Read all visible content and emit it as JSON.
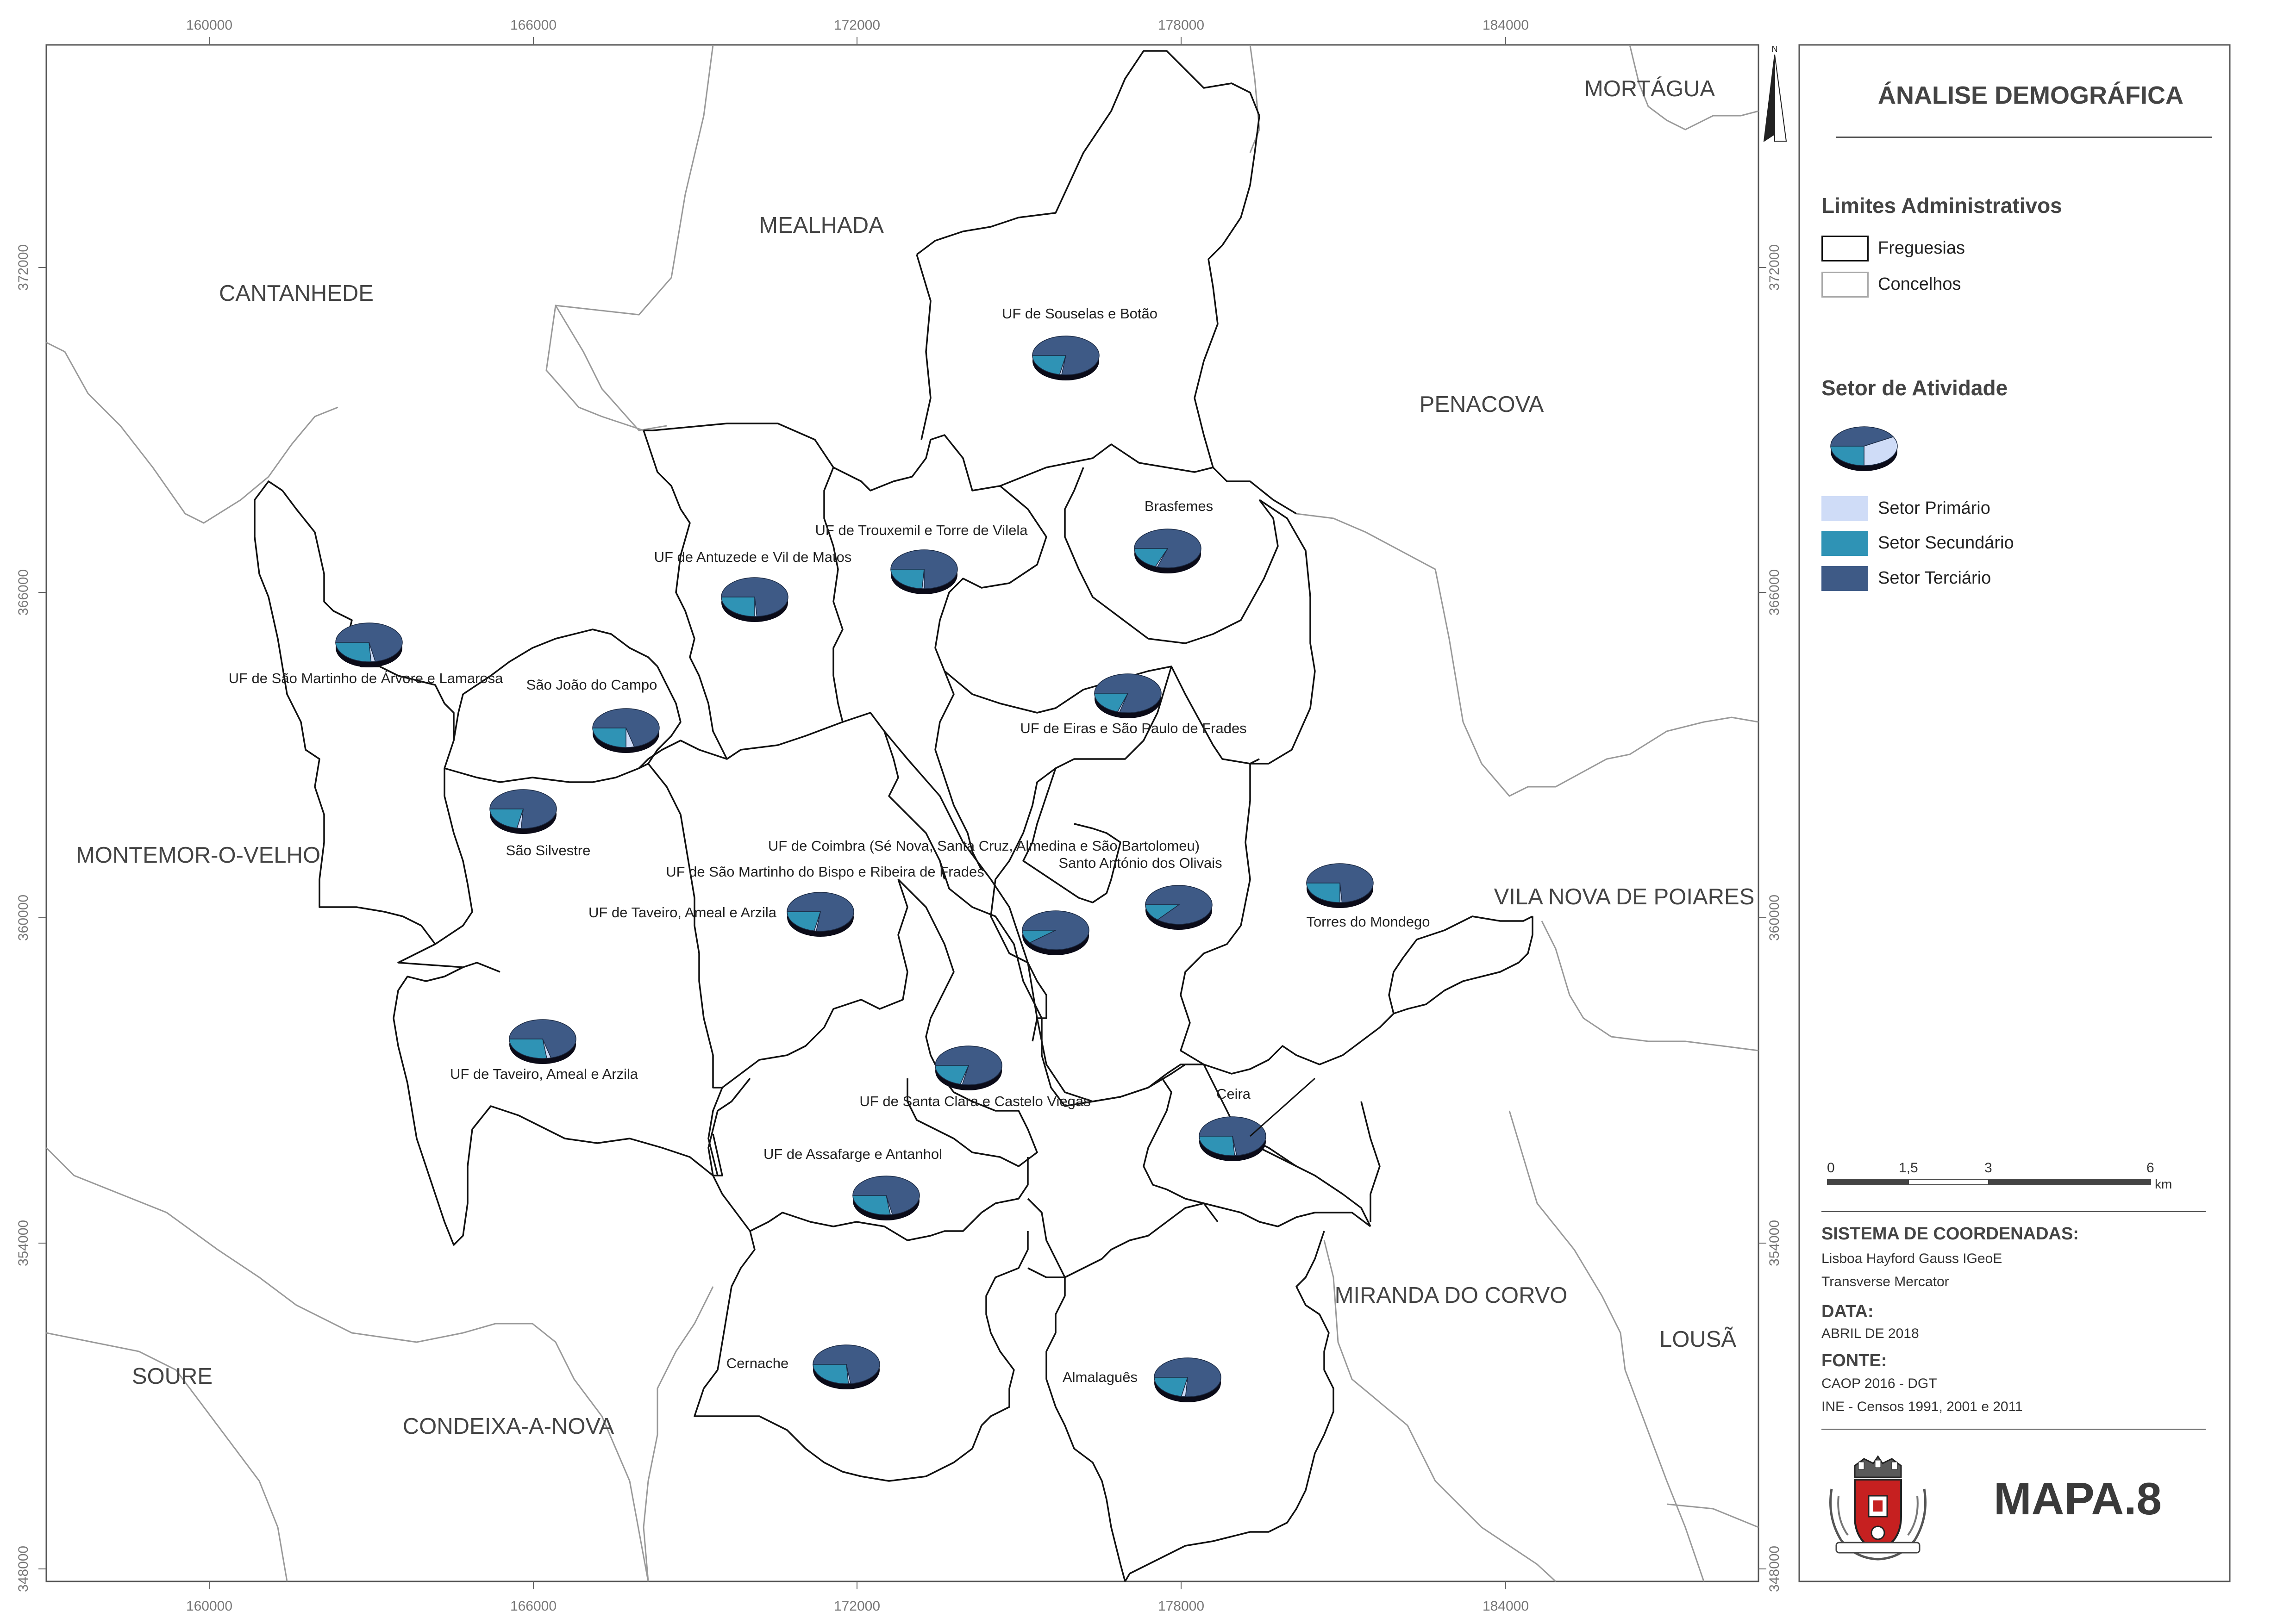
{
  "title": "ÁNALISE DEMOGRÁFICA",
  "map_number": "MAPA.8",
  "north_label": "N",
  "x_ticks": [
    "160000",
    "166000",
    "172000",
    "178000",
    "184000"
  ],
  "y_ticks": [
    "372000",
    "366000",
    "360000",
    "354000",
    "348000"
  ],
  "concelhos": [
    "MORTÁGUA",
    "MEALHADA",
    "CANTANHEDE",
    "PENACOVA",
    "MONTEMOR-O-VELHO",
    "VILA NOVA DE POIARES",
    "MIRANDA DO CORVO",
    "LOUSÃ",
    "SOURE",
    "CONDEIXA-A-NOVA"
  ],
  "freguesias": [
    {
      "name": "UF de Souselas e Botão",
      "primario": 0.01,
      "secundario": 0.22,
      "terciario": 0.77
    },
    {
      "name": "Brasfemes",
      "primario": 0.01,
      "secundario": 0.19,
      "terciario": 0.8
    },
    {
      "name": "UF de Trouxemil e Torre de Vilela",
      "primario": 0.01,
      "secundario": 0.24,
      "terciario": 0.75
    },
    {
      "name": "UF de Antuzede e Vil de Matos",
      "primario": 0.01,
      "secundario": 0.25,
      "terciario": 0.74
    },
    {
      "name": "UF de São Martinho de Árvore e Lamarosa",
      "primario": 0.02,
      "secundario": 0.26,
      "terciario": 0.72
    },
    {
      "name": "São João do Campo",
      "primario": 0.04,
      "secundario": 0.25,
      "terciario": 0.71
    },
    {
      "name": "UF de Eiras e São Paulo de Frades",
      "primario": 0.01,
      "secundario": 0.2,
      "terciario": 0.79
    },
    {
      "name": "São Silvestre",
      "primario": 0.02,
      "secundario": 0.22,
      "terciario": 0.76
    },
    {
      "name": "UF de Coimbra (Sé Nova, Santa Cruz, Almedina e São Bartolomeu)",
      "primario": 0.0,
      "secundario": 0.11,
      "terciario": 0.89
    },
    {
      "name": "Santo António dos Olivais",
      "primario": 0.0,
      "secundario": 0.14,
      "terciario": 0.86
    },
    {
      "name": "UF de São Martinho do Bispo e Ribeira de Frades",
      "primario": 0.01,
      "secundario": 0.22,
      "terciario": 0.77
    },
    {
      "name": "UF de Taveiro, Ameal e Arzila",
      "primario": 0.02,
      "secundario": 0.27,
      "terciario": 0.71
    },
    {
      "name": "Torres do Mondego",
      "primario": 0.01,
      "secundario": 0.25,
      "terciario": 0.74
    },
    {
      "name": "UF de Santa Clara e Castelo Viegas",
      "primario": 0.01,
      "secundario": 0.21,
      "terciario": 0.78
    },
    {
      "name": "Ceira",
      "primario": 0.01,
      "secundario": 0.26,
      "terciario": 0.73
    },
    {
      "name": "UF de Assafarge e Antanhol",
      "primario": 0.01,
      "secundario": 0.27,
      "terciario": 0.72
    },
    {
      "name": "Cernache",
      "primario": 0.01,
      "secundario": 0.26,
      "terciario": 0.73
    },
    {
      "name": "Almalaguês",
      "primario": 0.02,
      "secundario": 0.22,
      "terciario": 0.76
    }
  ],
  "legend": {
    "limites_title": "Limites Administrativos",
    "freguesias": "Freguesias",
    "concelhos": "Concelhos",
    "setor_title": "Setor de Atividade",
    "primario": "Setor Primário",
    "secundario": "Setor Secundário",
    "terciario": "Setor Terciário",
    "sample_pie": {
      "primario": 0.33,
      "secundario": 0.25,
      "terciario": 0.42
    }
  },
  "colors": {
    "primario": "#cfdcf7",
    "secundario": "#2f93b5",
    "terciario": "#3e5a86",
    "pie_shadow": "#0b0b18"
  },
  "scale": {
    "labels": [
      "0",
      "1,5",
      "3",
      "6"
    ],
    "unit": "km"
  },
  "coord": {
    "title": "SISTEMA DE COORDENADAS:",
    "line1": "Lisboa Hayford Gauss IGeoE",
    "line2": "Transverse Mercator"
  },
  "data_block": {
    "title": "DATA:",
    "value": "ABRIL DE 2018"
  },
  "fonte": {
    "title": "FONTE:",
    "line1": "CAOP 2016 - DGT",
    "line2": "INE - Censos 1991, 2001 e 2011"
  }
}
